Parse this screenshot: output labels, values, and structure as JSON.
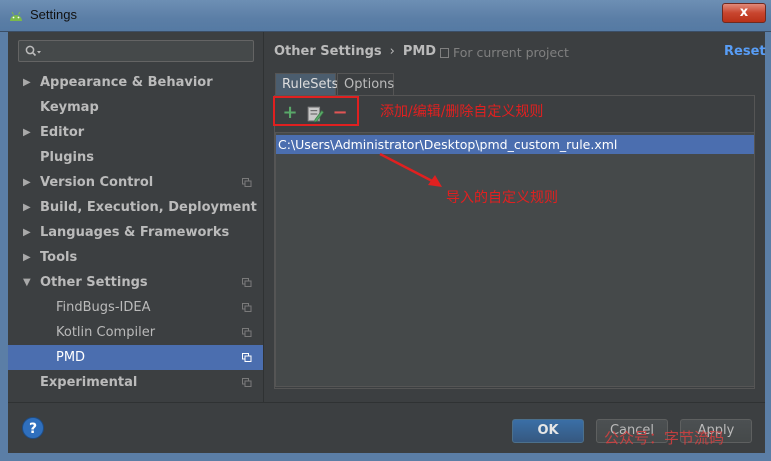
{
  "window": {
    "title": "Settings",
    "close_label": "x"
  },
  "search": {
    "placeholder": ""
  },
  "sidebar": {
    "items": [
      {
        "label": "Appearance & Behavior",
        "has_arrow": true,
        "expanded": false
      },
      {
        "label": "Keymap",
        "has_arrow": false
      },
      {
        "label": "Editor",
        "has_arrow": true,
        "expanded": false
      },
      {
        "label": "Plugins",
        "has_arrow": false
      },
      {
        "label": "Version Control",
        "has_arrow": true,
        "expanded": false,
        "project_icon": true
      },
      {
        "label": "Build, Execution, Deployment",
        "has_arrow": true,
        "expanded": false
      },
      {
        "label": "Languages & Frameworks",
        "has_arrow": true,
        "expanded": false
      },
      {
        "label": "Tools",
        "has_arrow": true,
        "expanded": false
      },
      {
        "label": "Other Settings",
        "has_arrow": true,
        "expanded": true,
        "project_icon": true
      },
      {
        "label": "FindBugs-IDEA",
        "child": true,
        "project_icon": true
      },
      {
        "label": "Kotlin Compiler",
        "child": true,
        "project_icon": true
      },
      {
        "label": "PMD",
        "child": true,
        "project_icon": true,
        "selected": true
      },
      {
        "label": "Experimental",
        "has_arrow": false,
        "project_icon": true
      }
    ]
  },
  "breadcrumb": {
    "parent": "Other Settings",
    "separator": "›",
    "current": "PMD"
  },
  "scope": {
    "label": "For current project"
  },
  "reset": {
    "label": "Reset"
  },
  "tabs": [
    {
      "label": "RuleSets",
      "active": true
    },
    {
      "label": "Options",
      "active": false
    }
  ],
  "toolbar": {
    "add_label": "+",
    "remove_label": "−"
  },
  "annotations": {
    "toolbar_note": "添加/编辑/删除自定义规则",
    "list_note": "导入的自定义规则"
  },
  "rulesets": [
    "C:\\Users\\Administrator\\Desktop\\pmd_custom_rule.xml"
  ],
  "buttons": {
    "help": "?",
    "ok": "OK",
    "cancel": "Cancel",
    "apply": "Apply"
  },
  "watermark": "公众号：字节流码",
  "colors": {
    "selection": "#4b6eaf",
    "accent_link": "#589df6",
    "annotation_red": "#e02020",
    "background": "#3c3f41"
  }
}
